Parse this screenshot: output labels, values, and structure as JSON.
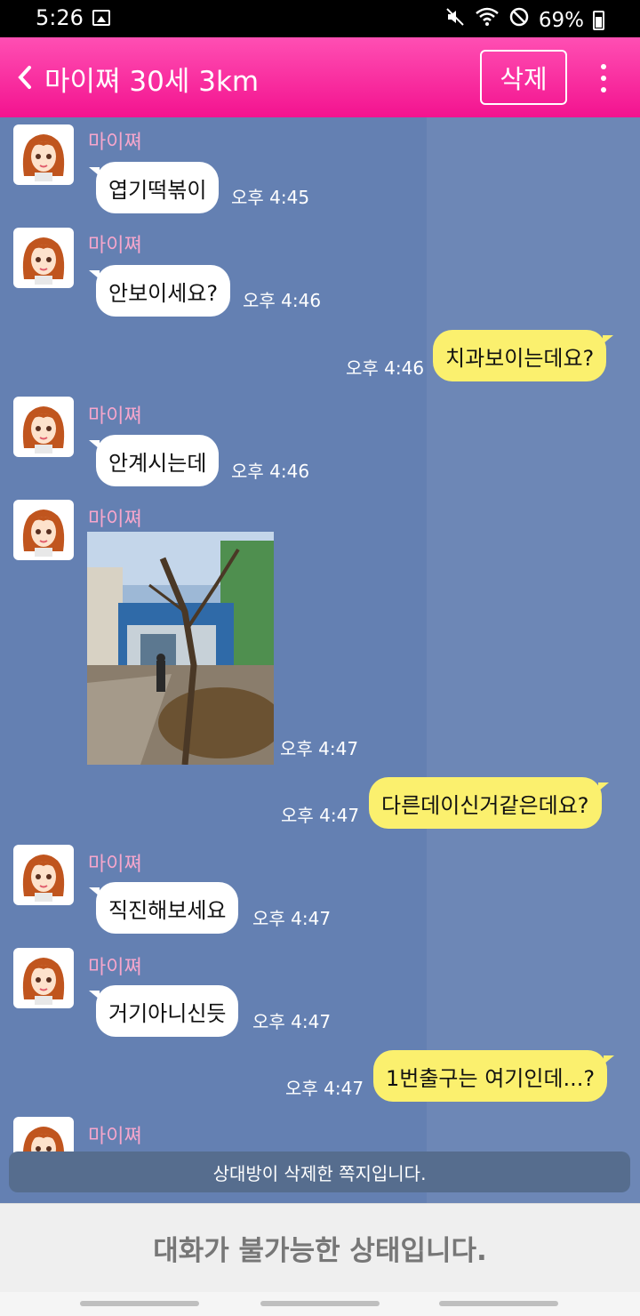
{
  "status_bar": {
    "time": "5:26",
    "battery": "69%",
    "icons": [
      "gallery-icon",
      "mute-icon",
      "wifi-icon",
      "do-not-disturb-icon",
      "battery-icon"
    ]
  },
  "header": {
    "title": "마이쪄 30세 3km",
    "delete_label": "삭제",
    "background": "#f3138f"
  },
  "messages": [
    {
      "direction": "in",
      "sender": "마이쪄",
      "text": "엽기떡볶이",
      "time": "오후 4:45"
    },
    {
      "direction": "in",
      "sender": "마이쪄",
      "text": "안보이세요?",
      "time": "오후 4:46"
    },
    {
      "direction": "out",
      "text": "치과보이는데요?",
      "time": "오후 4:46"
    },
    {
      "direction": "in",
      "sender": "마이쪄",
      "text": "안계시는데",
      "time": "오후 4:46"
    },
    {
      "direction": "in",
      "sender": "마이쪄",
      "type": "photo",
      "time": "오후 4:47"
    },
    {
      "direction": "out",
      "text": "다른데이신거같은데요?",
      "time": "오후 4:47"
    },
    {
      "direction": "in",
      "sender": "마이쪄",
      "text": "직진해보세요",
      "time": "오후 4:47"
    },
    {
      "direction": "in",
      "sender": "마이쪄",
      "text": "거기아니신듯",
      "time": "오후 4:47"
    },
    {
      "direction": "out",
      "text": "1번출구는 여기인데...?",
      "time": "오후 4:47"
    },
    {
      "direction": "in",
      "sender": "마이쪄"
    }
  ],
  "notice": "상대방이 삭제한 쪽지입니다.",
  "footer": {
    "status_text": "대화가 불가능한 상태입니다."
  },
  "colors": {
    "chat_background": "#6d87b6",
    "outgoing_bubble": "#fbf06e",
    "incoming_bubble": "#ffffff",
    "sender_name": "#f6a6cc"
  }
}
